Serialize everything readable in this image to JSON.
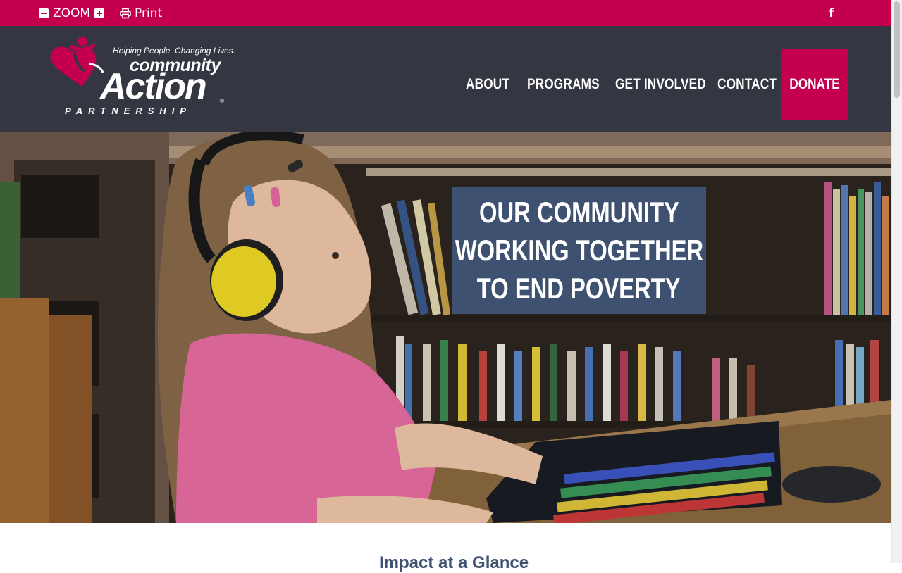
{
  "topbar": {
    "zoom_label": "ZOOM",
    "print_label": "Print",
    "facebook_glyph": "f",
    "bg_color": "#c4004e"
  },
  "header": {
    "logo": {
      "tagline": "Helping People. Changing Lives.",
      "line1": "community",
      "line2": "Action",
      "line3": "PARTNERSHIP",
      "registered": "®"
    },
    "nav": [
      {
        "label": "ABOUT"
      },
      {
        "label": "PROGRAMS"
      },
      {
        "label": "GET INVOLVED"
      },
      {
        "label": "CONTACT"
      }
    ],
    "donate_label": "DONATE",
    "bg_color": "#343741",
    "accent_color": "#c4004e"
  },
  "hero": {
    "tagline_lines": [
      "OUR COMMUNITY",
      "WORKING TOGETHER",
      "TO END POVERTY"
    ],
    "tagline_bg": "#3f5171"
  },
  "main": {
    "impact_heading": "Impact at a Glance"
  }
}
